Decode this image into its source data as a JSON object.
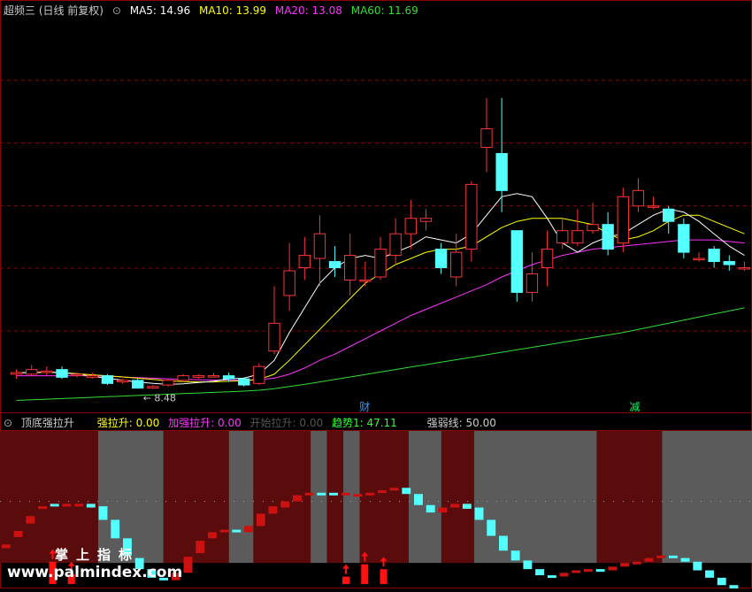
{
  "main_panel": {
    "title": "超频三 (日线 前复权)",
    "ma_labels": [
      {
        "text": "MA5: 14.96",
        "color": "#ffffff"
      },
      {
        "text": "MA10: 13.99",
        "color": "#ffff00"
      },
      {
        "text": "MA20: 13.08",
        "color": "#ff33ff"
      },
      {
        "text": "MA60: 11.69",
        "color": "#33dd33"
      }
    ],
    "low_price_label": "8.48",
    "markers": [
      {
        "text": "财",
        "color": "#3399ff"
      },
      {
        "text": "减",
        "color": "#00ff66"
      }
    ]
  },
  "sub_panel": {
    "title": "顶底强拉升",
    "labels": [
      {
        "text": "强拉升: 0.00",
        "color": "#ffff00"
      },
      {
        "text": "加强拉升: 0.00",
        "color": "#ff33ff"
      },
      {
        "text": "开始拉升: 0.00",
        "color": "#555555"
      },
      {
        "text": "趋势1: 47.11",
        "color": "#33ff33"
      },
      {
        "text": "强弱线: 50.00",
        "color": "#cccccc"
      }
    ]
  },
  "watermark": {
    "line1": "掌上指标",
    "line2": "www.palmindex.com"
  },
  "colors": {
    "up": "#ff3333",
    "down": "#54ffff",
    "grid": "#8b0000",
    "zone_red": "#5a0c0c",
    "zone_gray": "#5b5b5b",
    "ma5": "#ffffff",
    "ma10": "#ffff00",
    "ma20": "#ff33ff",
    "ma60": "#33dd33"
  },
  "chart_data": {
    "type": "candlestick",
    "ylim": [
      8.0,
      20.5
    ],
    "candles": [
      [
        8.95,
        9.0,
        9.1,
        8.8
      ],
      [
        8.95,
        9.1,
        9.25,
        8.9
      ],
      [
        9.05,
        9.05,
        9.2,
        8.9
      ],
      [
        9.1,
        8.85,
        9.2,
        8.8
      ],
      [
        8.95,
        8.95,
        9.0,
        8.85
      ],
      [
        8.85,
        8.9,
        9.0,
        8.8
      ],
      [
        8.9,
        8.65,
        8.95,
        8.6
      ],
      [
        8.7,
        8.75,
        8.8,
        8.65
      ],
      [
        8.75,
        8.5,
        8.8,
        8.48
      ],
      [
        8.5,
        8.55,
        8.6,
        8.48
      ],
      [
        8.6,
        8.75,
        8.8,
        8.55
      ],
      [
        8.75,
        8.9,
        8.95,
        8.7
      ],
      [
        8.85,
        8.9,
        8.95,
        8.8
      ],
      [
        8.9,
        8.9,
        9.0,
        8.85
      ],
      [
        8.9,
        8.8,
        9.0,
        8.7
      ],
      [
        8.8,
        8.6,
        8.85,
        8.55
      ],
      [
        8.65,
        9.2,
        9.3,
        8.6
      ],
      [
        9.7,
        10.6,
        11.8,
        9.6
      ],
      [
        11.5,
        12.3,
        13.2,
        11.0
      ],
      [
        12.4,
        12.8,
        13.4,
        12.0
      ],
      [
        12.7,
        13.5,
        14.1,
        11.8
      ],
      [
        12.6,
        12.4,
        13.1,
        12.1
      ],
      [
        12.0,
        12.8,
        13.5,
        11.5
      ],
      [
        12.0,
        12.0,
        12.6,
        11.8
      ],
      [
        12.1,
        13.0,
        13.4,
        12.0
      ],
      [
        12.8,
        13.5,
        14.0,
        12.5
      ],
      [
        13.5,
        14.0,
        14.6,
        13.0
      ],
      [
        13.9,
        14.0,
        14.3,
        13.6
      ],
      [
        13.0,
        12.4,
        13.2,
        12.2
      ],
      [
        12.1,
        12.9,
        13.5,
        11.8
      ],
      [
        13.0,
        15.1,
        15.2,
        12.6
      ],
      [
        16.3,
        16.9,
        17.9,
        15.5
      ],
      [
        16.1,
        14.9,
        17.9,
        14.2
      ],
      [
        13.6,
        11.6,
        13.6,
        11.3
      ],
      [
        11.6,
        12.2,
        12.9,
        11.3
      ],
      [
        12.4,
        13.0,
        13.6,
        11.8
      ],
      [
        13.2,
        13.6,
        14.0,
        13.0
      ],
      [
        13.2,
        13.6,
        14.3,
        13.1
      ],
      [
        13.6,
        13.8,
        14.5,
        13.5
      ],
      [
        13.8,
        13.0,
        14.2,
        12.8
      ],
      [
        13.2,
        14.7,
        15.0,
        12.9
      ],
      [
        14.4,
        14.9,
        15.3,
        14.2
      ],
      [
        14.4,
        14.4,
        14.7,
        14.3
      ],
      [
        14.3,
        13.9,
        14.4,
        13.5
      ],
      [
        13.8,
        12.9,
        14.0,
        12.7
      ],
      [
        12.7,
        12.7,
        12.9,
        12.6
      ],
      [
        13.0,
        12.6,
        13.1,
        12.4
      ],
      [
        12.6,
        12.5,
        12.8,
        12.3
      ],
      [
        12.4,
        12.4,
        12.6,
        12.3
      ]
    ],
    "ma5": [
      9.0,
      9.0,
      9.02,
      9.0,
      8.95,
      8.88,
      8.82,
      8.75,
      8.7,
      8.65,
      8.62,
      8.64,
      8.68,
      8.72,
      8.8,
      8.82,
      8.95,
      9.4,
      10.3,
      11.1,
      11.9,
      12.4,
      12.7,
      12.8,
      12.7,
      12.9,
      13.1,
      13.4,
      13.3,
      13.2,
      13.5,
      14.1,
      14.7,
      14.8,
      14.7,
      14.0,
      13.2,
      12.9,
      13.2,
      13.4,
      13.5,
      13.8,
      14.1,
      14.3,
      14.2,
      13.9,
      13.5,
      13.1,
      12.8
    ],
    "ma10": [
      9.0,
      9.0,
      9.01,
      9.0,
      8.97,
      8.93,
      8.9,
      8.86,
      8.82,
      8.78,
      8.74,
      8.71,
      8.7,
      8.7,
      8.72,
      8.74,
      8.78,
      8.95,
      9.4,
      9.9,
      10.4,
      10.9,
      11.4,
      11.9,
      12.2,
      12.5,
      12.7,
      12.9,
      13.0,
      13.0,
      13.1,
      13.4,
      13.7,
      13.9,
      14.0,
      14.0,
      14.0,
      13.9,
      13.8,
      13.5,
      13.3,
      13.4,
      13.6,
      13.9,
      14.1,
      14.1,
      13.9,
      13.7,
      13.5
    ],
    "ma20": [
      8.9,
      8.9,
      8.9,
      8.9,
      8.9,
      8.9,
      8.88,
      8.86,
      8.84,
      8.82,
      8.8,
      8.78,
      8.77,
      8.76,
      8.76,
      8.76,
      8.77,
      8.82,
      8.95,
      9.15,
      9.4,
      9.6,
      9.85,
      10.1,
      10.35,
      10.6,
      10.85,
      11.05,
      11.25,
      11.45,
      11.65,
      11.85,
      12.1,
      12.3,
      12.5,
      12.65,
      12.8,
      12.9,
      13.0,
      13.05,
      13.1,
      13.15,
      13.2,
      13.25,
      13.3,
      13.3,
      13.3,
      13.25,
      13.2
    ],
    "ma60": [
      8.1,
      8.12,
      8.14,
      8.16,
      8.18,
      8.2,
      8.22,
      8.24,
      8.26,
      8.28,
      8.3,
      8.32,
      8.34,
      8.36,
      8.38,
      8.4,
      8.43,
      8.48,
      8.55,
      8.62,
      8.7,
      8.78,
      8.86,
      8.94,
      9.02,
      9.1,
      9.18,
      9.26,
      9.34,
      9.42,
      9.5,
      9.58,
      9.66,
      9.74,
      9.82,
      9.9,
      9.98,
      10.06,
      10.14,
      10.22,
      10.3,
      10.4,
      10.5,
      10.6,
      10.7,
      10.8,
      10.9,
      11.0,
      11.1
    ],
    "indicator": {
      "strong_line": 50.0,
      "ylim": [
        0,
        100
      ],
      "bars": [
        [
          15,
          12
        ],
        [
          26,
          21
        ],
        [
          38,
          32
        ],
        [
          46,
          44
        ],
        [
          47,
          48
        ],
        [
          48,
          48
        ],
        [
          48,
          48
        ],
        [
          45,
          48
        ],
        [
          35,
          46
        ],
        [
          20,
          35
        ],
        [
          6,
          20
        ],
        [
          -5,
          4
        ],
        [
          -12,
          -5
        ],
        [
          -14,
          -12
        ],
        [
          -8,
          -14
        ],
        [
          5,
          -8
        ],
        [
          18,
          8
        ],
        [
          25,
          20
        ],
        [
          27,
          25
        ],
        [
          25,
          27
        ],
        [
          30,
          25
        ],
        [
          40,
          30
        ],
        [
          46,
          40
        ],
        [
          50,
          45
        ],
        [
          55,
          50
        ],
        [
          57,
          56
        ],
        [
          56,
          57
        ],
        [
          56,
          57
        ],
        [
          57,
          56
        ],
        [
          56,
          56
        ],
        [
          57,
          56
        ],
        [
          59,
          57
        ],
        [
          61,
          60
        ],
        [
          56,
          61
        ],
        [
          47,
          56
        ],
        [
          41,
          47
        ],
        [
          45,
          41
        ],
        [
          48,
          45
        ],
        [
          44,
          48
        ],
        [
          35,
          45
        ],
        [
          22,
          35
        ],
        [
          10,
          22
        ],
        [
          2,
          10
        ],
        [
          -5,
          2
        ],
        [
          -10,
          -5
        ],
        [
          -11,
          -10
        ],
        [
          -8,
          -11
        ],
        [
          -6,
          -8
        ],
        [
          -5,
          -6
        ],
        [
          -6,
          -5
        ],
        [
          -3,
          -6
        ],
        [
          0,
          -3
        ],
        [
          1,
          0
        ],
        [
          4,
          1
        ],
        [
          6,
          4
        ],
        [
          4,
          6
        ],
        [
          1,
          4
        ],
        [
          -6,
          1
        ],
        [
          -12,
          -6
        ],
        [
          -18,
          -12
        ],
        [
          -25,
          -18
        ],
        [
          -28,
          -25
        ]
      ],
      "zones": [
        [
          "red",
          0,
          12
        ],
        [
          "gray",
          12,
          20
        ],
        [
          "red",
          20,
          28
        ],
        [
          "gray",
          28,
          31
        ],
        [
          "red",
          31,
          38
        ],
        [
          "gray",
          38,
          40
        ],
        [
          "red",
          40,
          42
        ],
        [
          "gray",
          42,
          44
        ],
        [
          "red",
          44,
          50
        ],
        [
          "gray",
          50,
          54
        ],
        [
          "red",
          54,
          58
        ],
        [
          "gray",
          58,
          73
        ],
        [
          "red",
          73,
          81
        ],
        [
          "gray",
          81,
          92
        ]
      ],
      "spikes": [
        {
          "x": 0.07,
          "h": 18
        },
        {
          "x": 0.095,
          "h": 8
        },
        {
          "x": 0.46,
          "h": 6
        },
        {
          "x": 0.485,
          "h": 16
        },
        {
          "x": 0.51,
          "h": 12
        }
      ]
    }
  }
}
